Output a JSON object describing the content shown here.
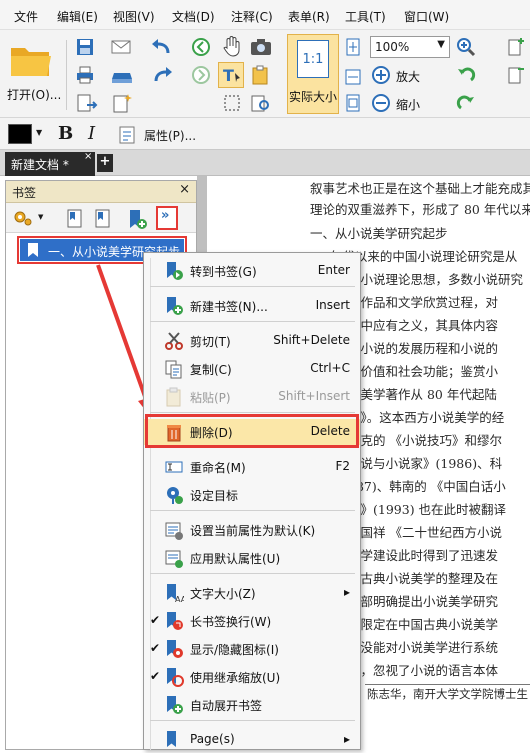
{
  "menubar": [
    "文件",
    "编辑(E)",
    "视图(V)",
    "文档(D)",
    "注释(C)",
    "表单(R)",
    "工具(T)",
    "窗口(W)"
  ],
  "toolbar": {
    "open_label": "打开(O)...",
    "actual_size_label": "实际大小",
    "actual_size_icon_text": "1:1",
    "zoom_value": "100%",
    "zoom_in_label": "放大",
    "zoom_out_label": "缩小"
  },
  "format": {
    "bold": "B",
    "italic": "I",
    "properties_label": "属性(P)..."
  },
  "tab": {
    "title": "新建文档 *",
    "add": "+"
  },
  "panel": {
    "title": "书签",
    "close": "×",
    "bookmark": "一、从小说美学研究起步"
  },
  "document": {
    "lines": [
      "叙事艺术也正是在这个基础上才能充成其",
      "理论的双重滋养下，形成了 80 年代以来中",
      "一、从小说美学研究起步",
      "80 年代以来的中国小说理论研究是从",
      "累小说理论思想，多数小说研究",
      "学作品和文学欣赏过程，对",
      "题中应有之义，其具体内容",
      "；小说的发展历程和小说的",
      "美价值和社会功能；鉴赏小",
      "说美学著作从 80 年代起陆",
      "观》。这本西方小说美学的经",
      "伯克的 《小说技巧》和缪尔",
      "小说与小说家》(1986)、科",
      "987)、韩南的 《中国白话小",
      "术》(1993) 也在此时被翻译",
      "罗国祥 《二十世纪西方小说",
      "美学建设此时得到了迅速发",
      "国古典小说美学的整理及在",
      "一部明确提出小说美学研究",
      "仅限定在中国古典小说美学",
      "，没能对小说美学进行系统",
      "入，忽视了小说的语言本体"
    ],
    "footnote": "陈志华，南开大学文学院博士生"
  },
  "context_menu": {
    "items": [
      {
        "label": "转到书签(G)",
        "shortcut": "Enter",
        "disabled": false,
        "checked": false,
        "icon": "goto-bookmark-icon"
      },
      {
        "label": "新建书签(N)...",
        "shortcut": "Insert",
        "disabled": false,
        "checked": false,
        "icon": "new-bookmark-icon"
      },
      {
        "label": "剪切(T)",
        "shortcut": "Shift+Delete",
        "disabled": false,
        "checked": false,
        "icon": "scissors-icon"
      },
      {
        "label": "复制(C)",
        "shortcut": "Ctrl+C",
        "disabled": false,
        "checked": false,
        "icon": "copy-icon"
      },
      {
        "label": "粘贴(P)",
        "shortcut": "Shift+Insert",
        "disabled": true,
        "checked": false,
        "icon": "paste-icon"
      },
      {
        "label": "删除(D)",
        "shortcut": "Delete",
        "disabled": false,
        "checked": false,
        "icon": "trash-icon"
      },
      {
        "label": "重命名(M)",
        "shortcut": "F2",
        "disabled": false,
        "checked": false,
        "icon": "rename-icon"
      },
      {
        "label": "设定目标",
        "shortcut": "",
        "disabled": false,
        "checked": false,
        "icon": "set-target-icon"
      },
      {
        "label": "设置当前属性为默认(K)",
        "shortcut": "",
        "disabled": false,
        "checked": false,
        "icon": "set-default-icon"
      },
      {
        "label": "应用默认属性(U)",
        "shortcut": "",
        "disabled": false,
        "checked": false,
        "icon": "apply-default-icon"
      },
      {
        "label": "文字大小(Z)",
        "shortcut": "",
        "disabled": false,
        "checked": false,
        "icon": "text-size-icon",
        "submenu": "▸"
      },
      {
        "label": "长书签换行(W)",
        "shortcut": "",
        "disabled": false,
        "checked": true,
        "icon": "wrap-icon"
      },
      {
        "label": "显示/隐藏图标(I)",
        "shortcut": "",
        "disabled": false,
        "checked": true,
        "icon": "show-icon-icon"
      },
      {
        "label": "使用继承缩放(U)",
        "shortcut": "",
        "disabled": false,
        "checked": true,
        "icon": "inherit-zoom-icon"
      },
      {
        "label": "自动展开书签",
        "shortcut": "",
        "disabled": false,
        "checked": false,
        "icon": "expand-icon"
      },
      {
        "label": "Page(s)",
        "shortcut": "",
        "disabled": false,
        "checked": false,
        "icon": "pages-icon",
        "submenu": "▸"
      }
    ],
    "check_mark": "✔"
  },
  "colors": {
    "highlight_red": "#e53935",
    "selection_blue": "#2f6fc8",
    "panel_header": "#efe6c6",
    "menu_hover": "#fbe7a8"
  }
}
